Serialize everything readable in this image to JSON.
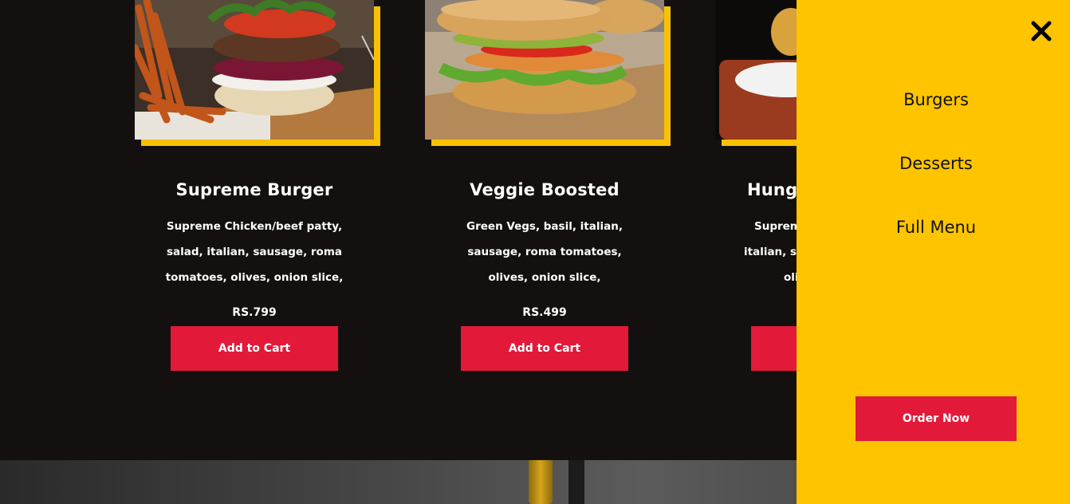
{
  "menu": {
    "items": [
      {
        "title": "Supreme Burger",
        "description": "Supreme Chicken/beef patty, salad, italian, sausage, roma tomatoes, olives, onion slice,",
        "price": "RS.799",
        "button_label": "Add to Cart"
      },
      {
        "title": "Veggie Boosted",
        "description": "Green Vegs, basil, italian, sausage, roma tomatoes, olives, onion slice,",
        "price": "RS.499",
        "button_label": "Add to Cart"
      },
      {
        "title": "Hungr",
        "description": "Suprem italian, sa oli",
        "price": "",
        "button_label": ""
      }
    ]
  },
  "drawer": {
    "close_icon": "close-icon",
    "links": [
      "Burgers",
      "Desserts",
      "Full Menu"
    ],
    "order_button": "Order Now"
  },
  "colors": {
    "background": "#141010",
    "accent_yellow": "#fec400",
    "button_red": "#e3193a",
    "text_white": "#ffffff"
  }
}
